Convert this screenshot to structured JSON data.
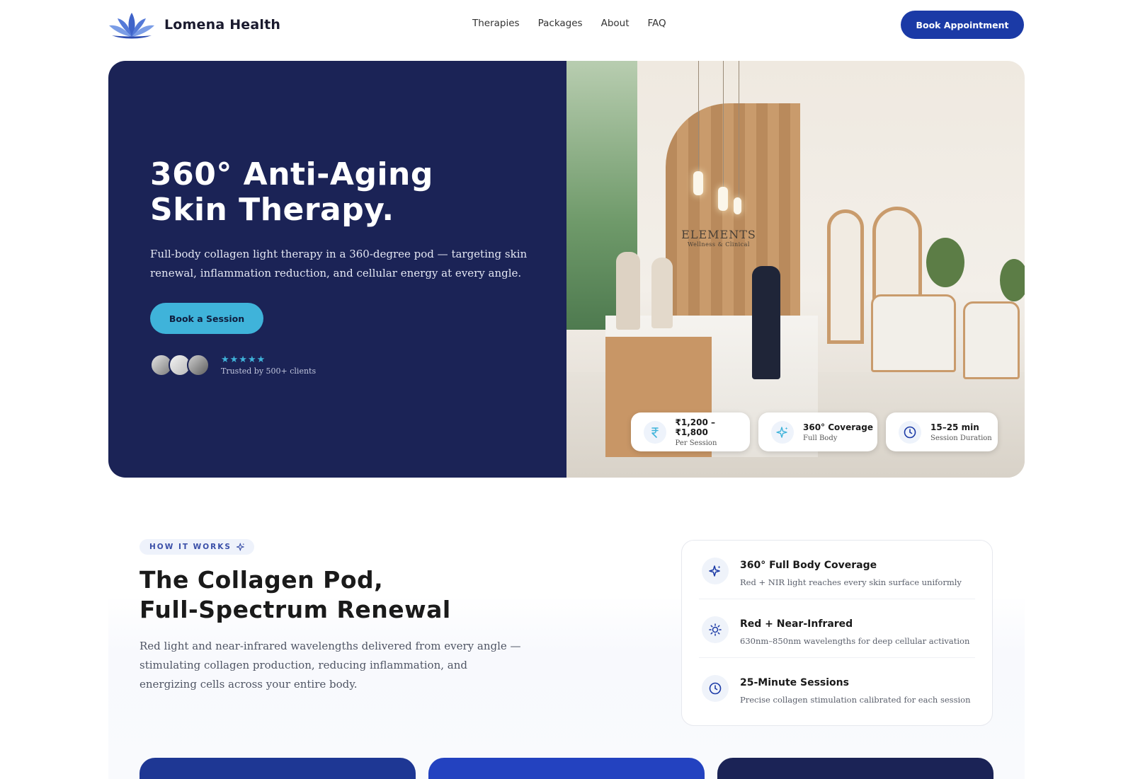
{
  "brand": {
    "name": "Lomena Health"
  },
  "nav": {
    "links": [
      "Therapies",
      "Packages",
      "About",
      "FAQ"
    ],
    "cta": "Book Appointment"
  },
  "hero": {
    "title_line1": "360° Anti-Aging",
    "title_line2": "Skin Therapy.",
    "subtitle": "Full-body collagen light therapy in a 360-degree pod — targeting skin renewal, inflammation reduction, and cellular energy at every angle.",
    "cta": "Book a Session",
    "rating_stars": 5,
    "stars": "★★★★★",
    "trust_label": "Trusted by 500+ clients",
    "image_sign": "ELEMENTS",
    "image_sign_sub": "Wellness & Clinical",
    "stats": [
      {
        "icon": "rupee-icon",
        "value": "₹1,200 – ₹1,800",
        "label": "Per Session"
      },
      {
        "icon": "sparkle-icon",
        "value": "360° Coverage",
        "label": "Full Body"
      },
      {
        "icon": "clock-icon",
        "value": "15–25 min",
        "label": "Session Duration"
      }
    ]
  },
  "how_it_works": {
    "eyebrow": "HOW IT WORKS",
    "title_line1": "The Collagen Pod,",
    "title_line2": "Full-Spectrum Renewal",
    "description": "Red light and near-infrared wavelengths delivered from every angle — stimulating collagen production, reducing inflammation, and energizing cells across your entire body.",
    "features": [
      {
        "icon": "sparkle-icon",
        "title": "360° Full Body Coverage",
        "desc": "Red + NIR light reaches every skin surface uniformly"
      },
      {
        "icon": "sun-icon",
        "title": "Red + Near-Infrared",
        "desc": "630nm–850nm wavelengths for deep cellular activation"
      },
      {
        "icon": "clock-icon",
        "title": "25-Minute Sessions",
        "desc": "Precise collagen stimulation calibrated for each session"
      }
    ]
  },
  "colors": {
    "navy": "#1b2356",
    "accent_blue": "#1b3aa6",
    "accent_cyan": "#3fb3da",
    "card_blue_1": "#1e3794",
    "card_blue_2": "#2342c0",
    "card_blue_3": "#1b2356"
  }
}
